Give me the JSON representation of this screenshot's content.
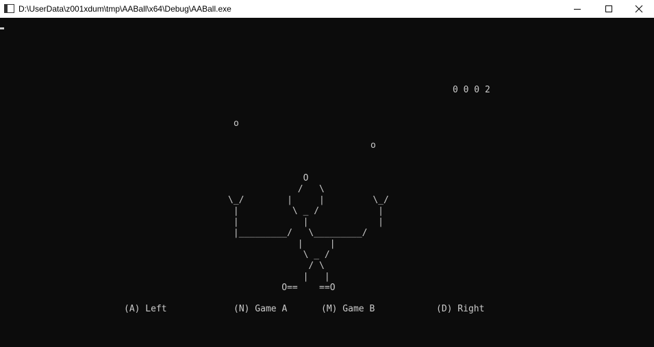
{
  "window": {
    "title": "D:\\UserData\\z001xdum\\tmp\\AABall\\x64\\Debug\\AABall.exe",
    "icon": "console-app-icon",
    "controls": [
      "minimize-icon",
      "maximize-icon",
      "close-icon"
    ]
  },
  "game": {
    "score": "0 0 0 2",
    "ball_glyph": "o",
    "juggler_art": "              O\n             /   \\\n\\_/        |     |         \\_/\n |          \\ _ /           |\n |            |             |\n |_________/   \\_________/\n             |     |\n              \\ _ /\n               / \\\n              |   |\n          O==    ==O"
  },
  "controls": {
    "left": "(A) Left",
    "game_a": "(N) Game A",
    "game_b": "(M) Game B",
    "right": "(D) Right"
  },
  "colors": {
    "console_bg": "#0c0c0c",
    "console_fg": "#cccccc",
    "titlebar_bg": "#ffffff"
  }
}
